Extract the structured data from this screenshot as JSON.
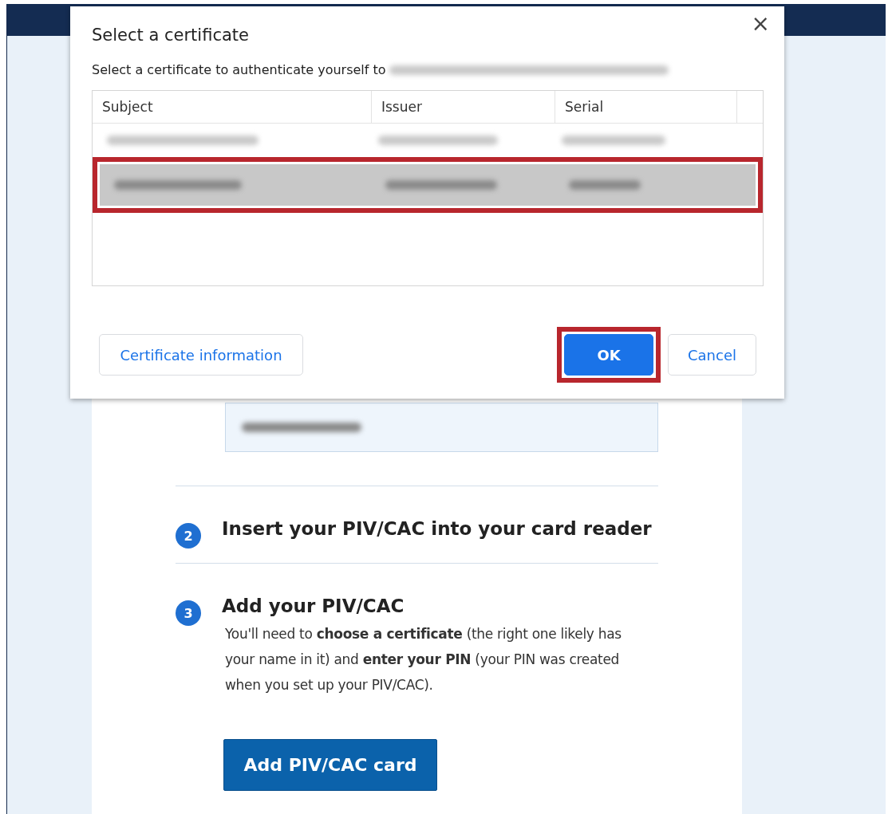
{
  "dialog": {
    "title": "Select a certificate",
    "prompt": "Select a certificate to authenticate yourself to",
    "columns": [
      "Subject",
      "Issuer",
      "Serial"
    ],
    "rows": [
      {
        "selected": false
      },
      {
        "selected": true
      }
    ],
    "buttons": [
      {
        "kind": "secondary",
        "label": "Certificate information",
        "highlighted": false
      },
      {
        "kind": "primary",
        "label": "OK",
        "highlighted": true
      },
      {
        "kind": "secondary",
        "label": "Cancel",
        "highlighted": false
      }
    ],
    "close": "×"
  },
  "page": {
    "steps": [
      {
        "number": "2",
        "title": "Insert your PIV/CAC into your card reader"
      },
      {
        "number": "3",
        "title": "Add your PIV/CAC",
        "text": "You'll need to **choose a certificate** (the right one likely has your name in it) and **enter your PIN** (your PIN was created when you set up your PIV/CAC).",
        "button": "Add PIV/CAC card"
      }
    ]
  }
}
